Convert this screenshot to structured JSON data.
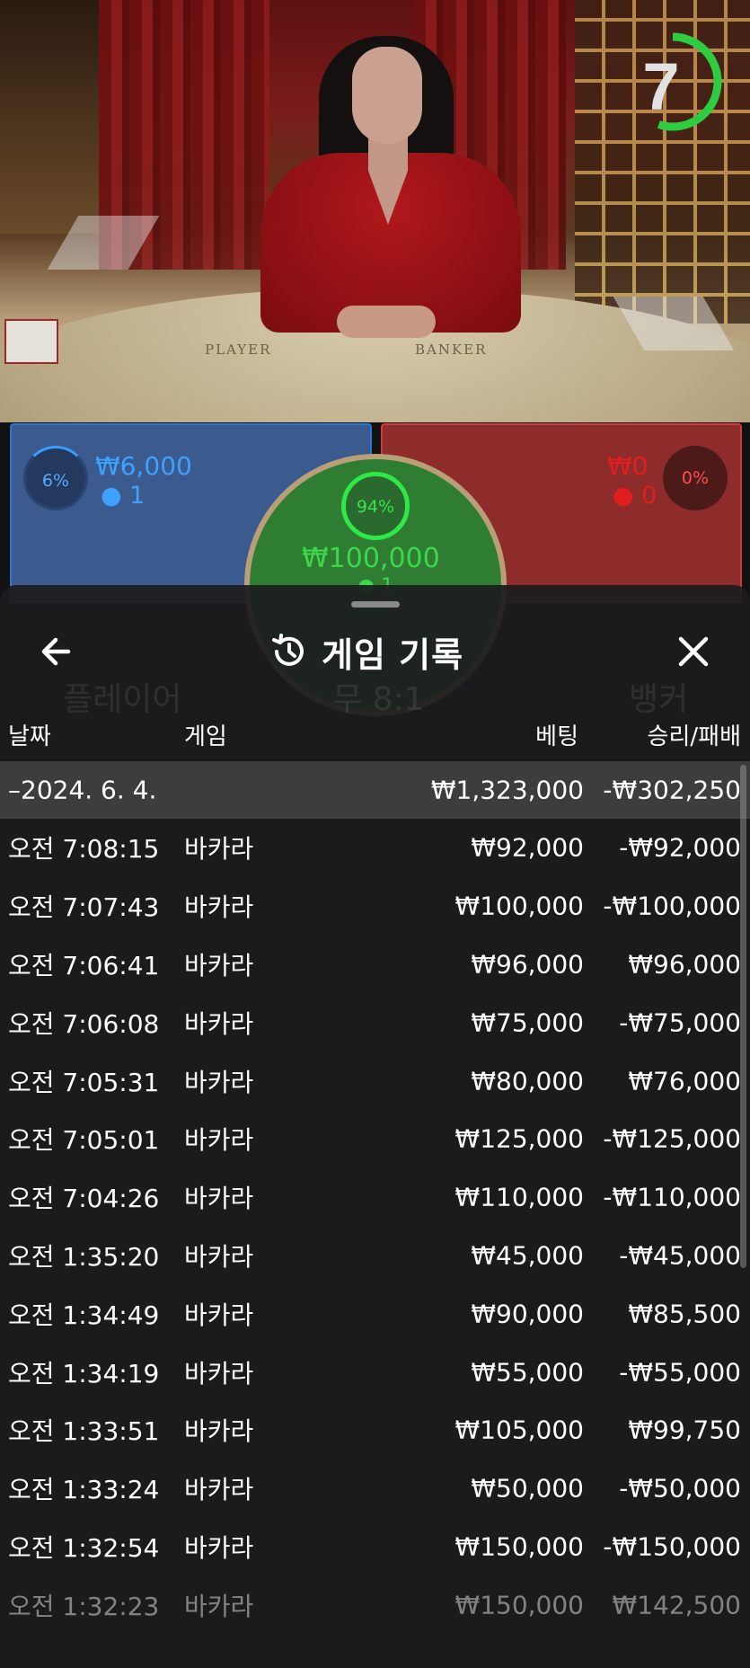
{
  "video": {
    "table_labels": {
      "player": "PLAYER",
      "banker": "BANKER"
    },
    "countdown": "7",
    "countdown_fraction": 0.55
  },
  "bets": {
    "player": {
      "percent": "6%",
      "amount": "₩6,000",
      "count": "1",
      "color": "#3ea0ff"
    },
    "tie": {
      "percent": "94%",
      "amount": "₩100,000",
      "count": "1",
      "color": "#3cd84b"
    },
    "banker": {
      "percent": "0%",
      "amount": "₩0",
      "count": "0",
      "color": "#e01e1e"
    }
  },
  "history": {
    "title": "게임 기록",
    "back_icon": "arrow-left-icon",
    "title_icon": "history-clock-icon",
    "close_icon": "close-x-icon",
    "headers": {
      "date": "날짜",
      "game": "게임",
      "bet": "베팅",
      "result": "승리/패배"
    },
    "date_group": {
      "date": "–2024. 6. 4.",
      "bet_total": "₩1,323,000",
      "result_total": "-₩302,250"
    },
    "rows": [
      {
        "time": "오전 7:08:15",
        "game": "바카라",
        "bet": "₩92,000",
        "result": "-₩92,000"
      },
      {
        "time": "오전 7:07:43",
        "game": "바카라",
        "bet": "₩100,000",
        "result": "-₩100,000"
      },
      {
        "time": "오전 7:06:41",
        "game": "바카라",
        "bet": "₩96,000",
        "result": "₩96,000"
      },
      {
        "time": "오전 7:06:08",
        "game": "바카라",
        "bet": "₩75,000",
        "result": "-₩75,000"
      },
      {
        "time": "오전 7:05:31",
        "game": "바카라",
        "bet": "₩80,000",
        "result": "₩76,000"
      },
      {
        "time": "오전 7:05:01",
        "game": "바카라",
        "bet": "₩125,000",
        "result": "-₩125,000"
      },
      {
        "time": "오전 7:04:26",
        "game": "바카라",
        "bet": "₩110,000",
        "result": "-₩110,000"
      },
      {
        "time": "오전 1:35:20",
        "game": "바카라",
        "bet": "₩45,000",
        "result": "-₩45,000"
      },
      {
        "time": "오전 1:34:49",
        "game": "바카라",
        "bet": "₩90,000",
        "result": "₩85,500"
      },
      {
        "time": "오전 1:34:19",
        "game": "바카라",
        "bet": "₩55,000",
        "result": "-₩55,000"
      },
      {
        "time": "오전 1:33:51",
        "game": "바카라",
        "bet": "₩105,000",
        "result": "₩99,750"
      },
      {
        "time": "오전 1:33:24",
        "game": "바카라",
        "bet": "₩50,000",
        "result": "-₩50,000"
      },
      {
        "time": "오전 1:32:54",
        "game": "바카라",
        "bet": "₩150,000",
        "result": "-₩150,000"
      },
      {
        "time": "오전 1:32:23",
        "game": "바카라",
        "bet": "₩150,000",
        "result": "₩142,500"
      }
    ]
  },
  "background_labels": {
    "player": "플레이어",
    "tie": "무 8:1",
    "banker": "뱅커"
  }
}
